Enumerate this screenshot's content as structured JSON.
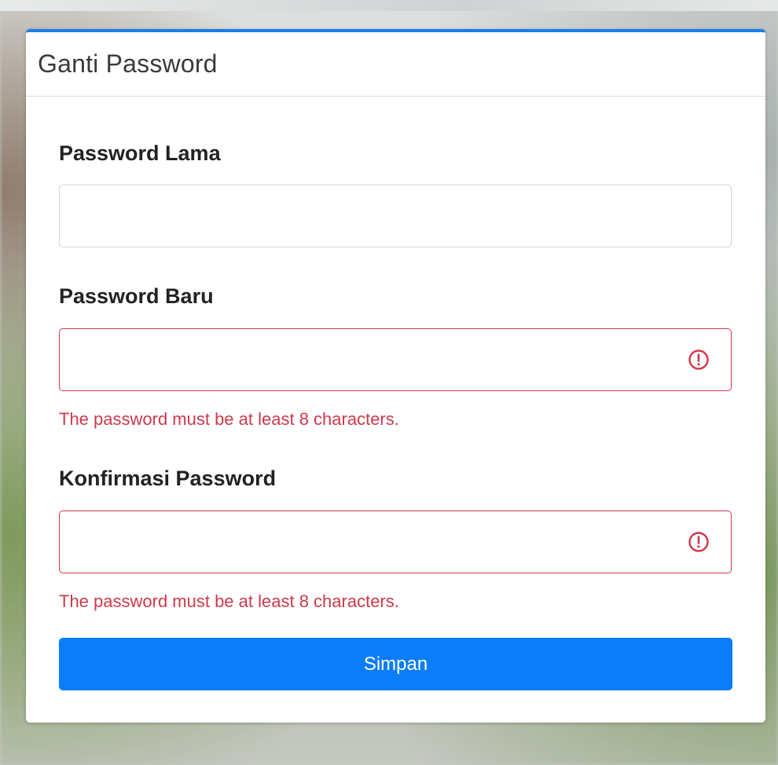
{
  "card": {
    "title": "Ganti Password"
  },
  "form": {
    "old_password": {
      "label": "Password Lama",
      "value": ""
    },
    "new_password": {
      "label": "Password Baru",
      "value": "",
      "error": "The password must be at least 8 characters."
    },
    "confirm_password": {
      "label": "Konfirmasi Password",
      "value": "",
      "error": "The password must be at least 8 characters."
    },
    "submit_label": "Simpan"
  },
  "colors": {
    "accent": "#0b7df9",
    "header_border": "#1a7ee6",
    "error": "#cc3a4b"
  },
  "icons": {
    "field_error": "exclamation-circle-icon"
  }
}
